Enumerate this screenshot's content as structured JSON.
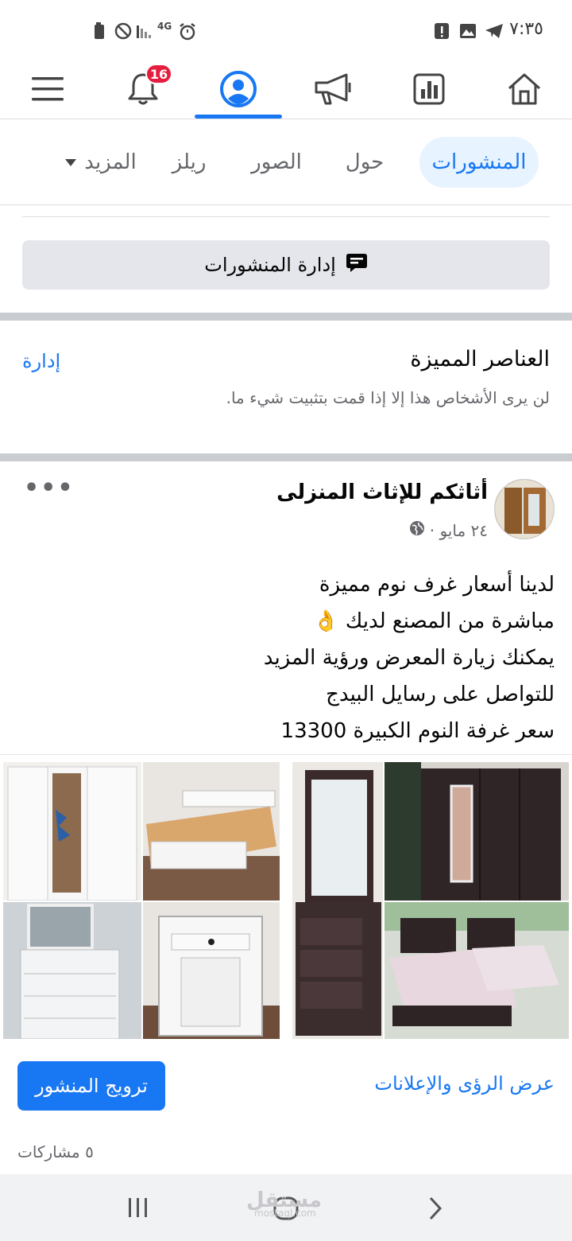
{
  "status_bar": {
    "time": "٧:٣٥",
    "network": "4G"
  },
  "top_nav": {
    "notification_count": "16",
    "active_tab": "profile"
  },
  "profile_tabs": [
    {
      "label": "المنشورات",
      "active": true
    },
    {
      "label": "حول",
      "active": false
    },
    {
      "label": "الصور",
      "active": false
    },
    {
      "label": "ريلز",
      "active": false
    },
    {
      "label": "المزيد",
      "active": false
    }
  ],
  "manage_posts": {
    "label": "إدارة المنشورات"
  },
  "featured": {
    "title": "العناصر المميزة",
    "manage_label": "إدارة",
    "description": "لن يرى الأشخاص هذا إلا إذا قمت بتثبيت شيء ما."
  },
  "post": {
    "author": "أثاثكم للإثاث المنزلى",
    "date": "٢٤ مايو ·",
    "lines": [
      "لدينا أسعار غرف نوم مميزة",
      "مباشرة من المصنع لديك 👌",
      "يمكنك زيارة المعرض ورؤية المزيد",
      "للتواصل على رسايل البيدج",
      "سعر غرفة النوم الكبيرة 13300"
    ],
    "insights_label": "عرض الرؤى والإعلانات",
    "boost_label": "ترويج المنشور",
    "shares": "٥ مشاركات"
  },
  "watermark": {
    "text": "مستقل",
    "sub": "mostaql.com"
  },
  "colors": {
    "accent": "#1877f2",
    "badge": "#e41e3f"
  }
}
